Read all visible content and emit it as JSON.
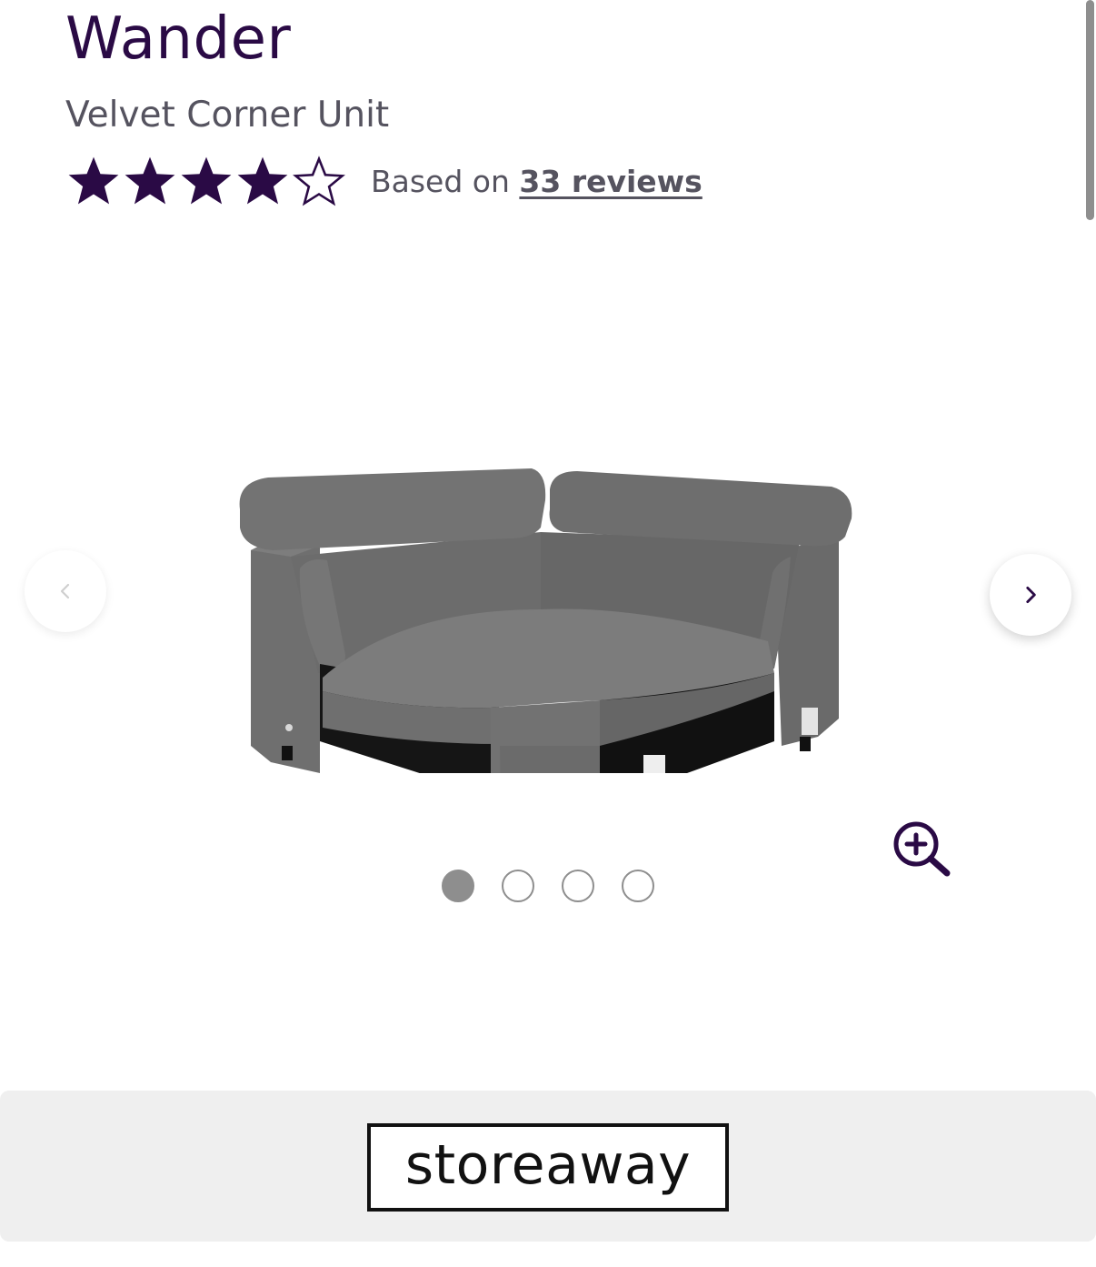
{
  "product": {
    "title": "Wander",
    "subtitle": "Velvet Corner Unit"
  },
  "rating": {
    "stars_filled": 4,
    "stars_total": 5,
    "based_on_label": "Based on",
    "reviews_link": "33 reviews",
    "star_color": "#2a0a45"
  },
  "gallery": {
    "current_slide": 1,
    "total_slides": 4,
    "prev_icon": "chevron-left-icon",
    "next_icon": "chevron-right-icon",
    "zoom_icon": "zoom-in-icon"
  },
  "footer": {
    "brand": "storeaway"
  },
  "colors": {
    "primary": "#2a0a45",
    "muted_text": "#55535f",
    "dot_gray": "#8e8e8e",
    "banner_bg": "#efefef"
  }
}
